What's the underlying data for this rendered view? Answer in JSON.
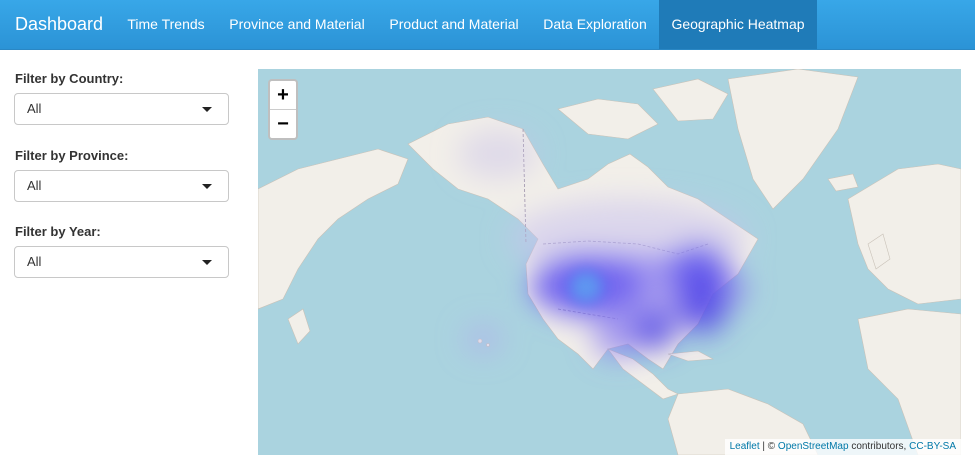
{
  "navbar": {
    "brand": "Dashboard",
    "items": [
      {
        "label": "Time Trends",
        "active": false
      },
      {
        "label": "Province and Material",
        "active": false
      },
      {
        "label": "Product and Material",
        "active": false
      },
      {
        "label": "Data Exploration",
        "active": false
      },
      {
        "label": "Geographic Heatmap",
        "active": true
      }
    ]
  },
  "filters": [
    {
      "label": "Filter by Country:",
      "value": "All"
    },
    {
      "label": "Filter by Province:",
      "value": "All"
    },
    {
      "label": "Filter by Year:",
      "value": "All"
    }
  ],
  "map": {
    "zoom_in": "+",
    "zoom_out": "−",
    "attribution": {
      "leaflet": "Leaflet",
      "separator": "| ©",
      "osm": "OpenStreetMap",
      "contributors": "contributors,",
      "license": "CC-BY-SA"
    }
  },
  "colors": {
    "nav": "#2b93d6",
    "nav_active": "#1f7bb8",
    "ocean": "#aad3df",
    "land": "#f2efe9",
    "heat": "#7a6cf0"
  }
}
